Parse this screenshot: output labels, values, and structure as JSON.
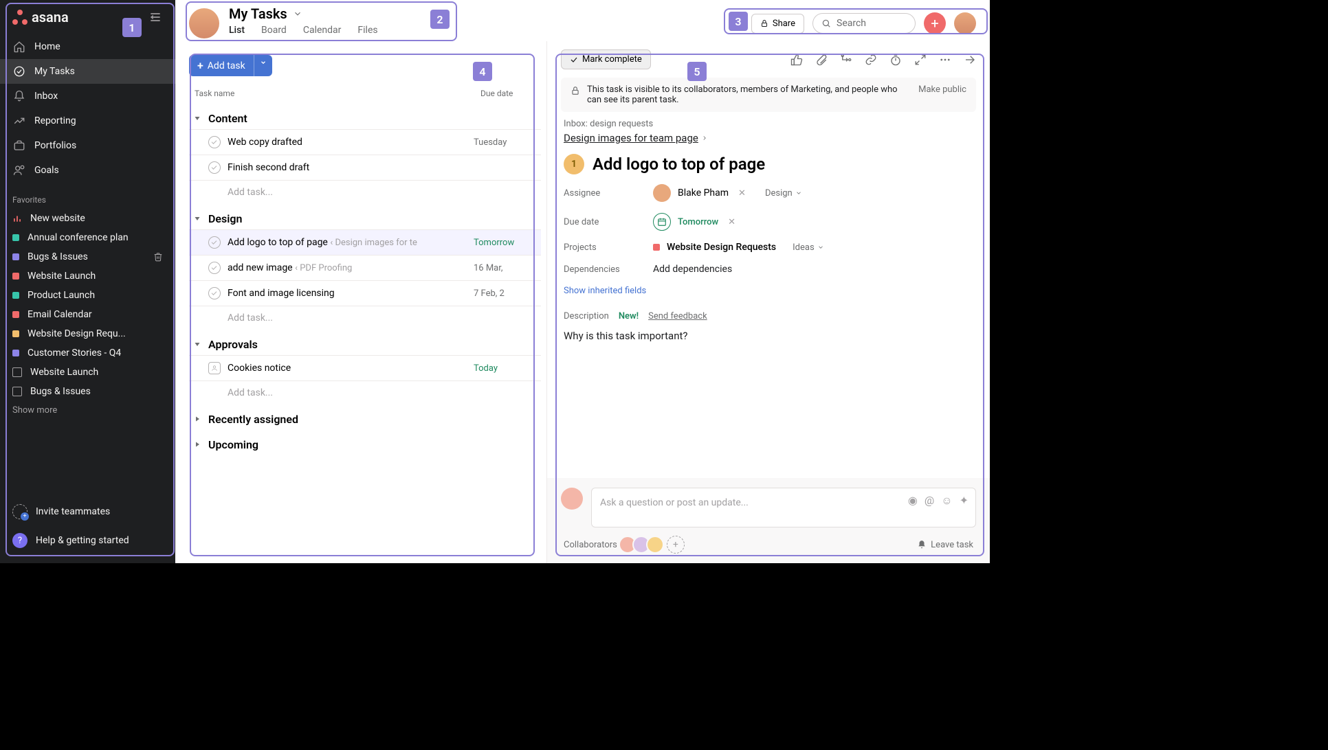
{
  "brand": "asana",
  "markers": {
    "m1": "1",
    "m2": "2",
    "m3": "3",
    "m4": "4",
    "m5": "5"
  },
  "nav": {
    "home": "Home",
    "mytasks": "My Tasks",
    "inbox": "Inbox",
    "reporting": "Reporting",
    "portfolios": "Portfolios",
    "goals": "Goals",
    "favorites_label": "Favorites",
    "favorites": [
      {
        "label": "New website",
        "type": "chart",
        "color": "#f06a6a"
      },
      {
        "label": "Annual conference plan",
        "type": "dot",
        "color": "#37c5ab"
      },
      {
        "label": "Bugs & Issues",
        "type": "dot",
        "color": "#8d84e8",
        "trash": true
      },
      {
        "label": "Website Launch",
        "type": "dot",
        "color": "#f06a6a"
      },
      {
        "label": "Product Launch",
        "type": "dot",
        "color": "#37c5ab"
      },
      {
        "label": "Email Calendar",
        "type": "dot",
        "color": "#f06a6a"
      },
      {
        "label": "Website Design Requ...",
        "type": "dot",
        "color": "#f1bd6c"
      },
      {
        "label": "Customer Stories - Q4",
        "type": "dot",
        "color": "#8d84e8"
      },
      {
        "label": "Website Launch",
        "type": "board",
        "color": "#a2a0a2"
      },
      {
        "label": "Bugs & Issues",
        "type": "board",
        "color": "#a2a0a2"
      }
    ],
    "show_more": "Show more",
    "invite": "Invite teammates",
    "help": "Help & getting started"
  },
  "header": {
    "title": "My Tasks",
    "tabs": {
      "list": "List",
      "board": "Board",
      "calendar": "Calendar",
      "files": "Files"
    },
    "share": "Share",
    "search_placeholder": "Search"
  },
  "list": {
    "add_task": "Add task",
    "col_name": "Task name",
    "col_date": "Due date",
    "sections": [
      {
        "name": "Content",
        "tasks": [
          {
            "name": "Web copy drafted",
            "date": "Tuesday",
            "dateClass": ""
          },
          {
            "name": "Finish second draft",
            "date": "",
            "dateClass": ""
          }
        ]
      },
      {
        "name": "Design",
        "tasks": [
          {
            "name": "Add logo to top of page",
            "parent": "Design images for te",
            "date": "Tomorrow",
            "dateClass": "green",
            "selected": true
          },
          {
            "name": "add new image",
            "parent": "PDF Proofing",
            "date": "16 Mar,",
            "dateClass": ""
          },
          {
            "name": "Font and image licensing",
            "date": "7 Feb, 2",
            "dateClass": ""
          }
        ]
      },
      {
        "name": "Approvals",
        "approval": true,
        "tasks": [
          {
            "name": "Cookies notice",
            "date": "Today",
            "dateClass": "green",
            "approval": true
          }
        ]
      },
      {
        "name": "Recently assigned",
        "collapsed": true,
        "tasks": []
      },
      {
        "name": "Upcoming",
        "collapsed": true,
        "tasks": []
      }
    ],
    "add_placeholder": "Add task..."
  },
  "detail": {
    "mark_complete": "Mark complete",
    "visibility": "This task is visible to its collaborators, members of Marketing, and people who can see its parent task.",
    "make_public": "Make public",
    "breadcrumb_top": "Inbox: design requests",
    "parent_link": "Design images for team page",
    "count": "1",
    "title": "Add logo to top of page",
    "labels": {
      "assignee": "Assignee",
      "due": "Due date",
      "projects": "Projects",
      "deps": "Dependencies",
      "desc": "Description"
    },
    "assignee": "Blake Pham",
    "assignee_section": "Design",
    "due": "Tomorrow",
    "project": "Website Design Requests",
    "project_section": "Ideas",
    "add_deps": "Add dependencies",
    "show_inherited": "Show inherited fields",
    "desc_new": "New!",
    "desc_feedback": "Send feedback",
    "description": "Why is this task important?",
    "comment_placeholder": "Ask a question or post an update...",
    "collaborators_label": "Collaborators",
    "leave": "Leave task"
  }
}
